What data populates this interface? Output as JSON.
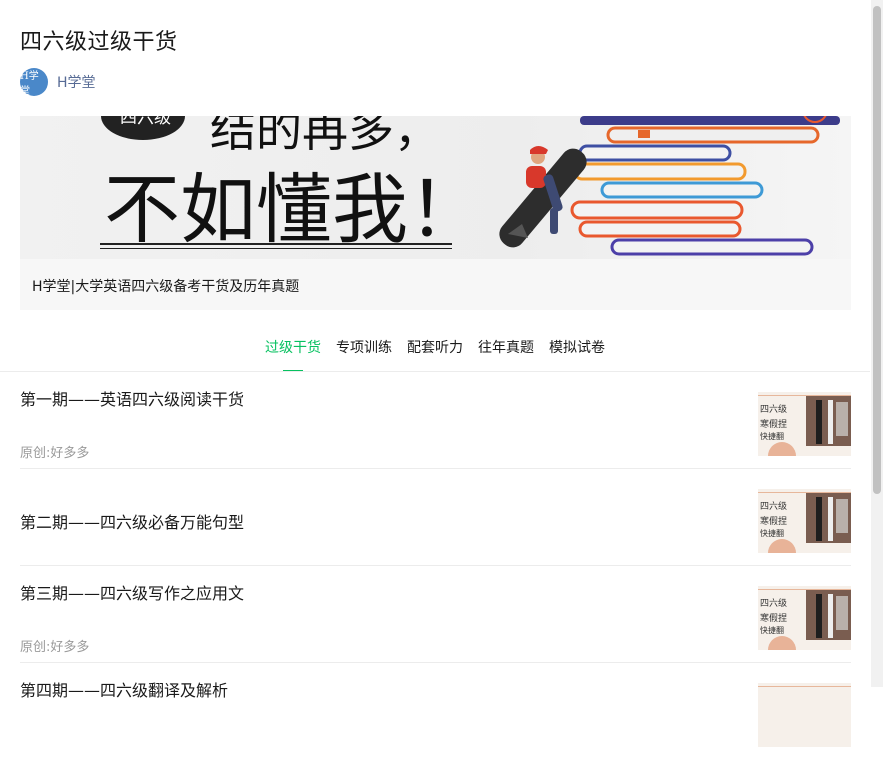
{
  "title": "四六级过级干货",
  "author": {
    "name": "H学堂",
    "avatar_text": "H学堂"
  },
  "banner": {
    "badge_text": "四六级",
    "line1": "结的再多，",
    "line1_highlight": "再多",
    "line2": "不如懂我！",
    "caption": "H学堂|大学英语四六级备考干货及历年真题"
  },
  "tabs": [
    {
      "label": "过级干货",
      "active": true
    },
    {
      "label": "专项训练"
    },
    {
      "label": "配套听力"
    },
    {
      "label": "往年真题"
    },
    {
      "label": "模拟试卷"
    }
  ],
  "articles": [
    {
      "title": "第一期——英语四六级阅读干货",
      "source": "原创:好多多"
    },
    {
      "title": "第二期——四六级必备万能句型",
      "source": ""
    },
    {
      "title": "第三期——四六级写作之应用文",
      "source": "原创:好多多"
    },
    {
      "title": "第四期——四六级翻译及解析",
      "source": ""
    }
  ],
  "thumb": {
    "line1": "四六级",
    "line2": "寒假捏",
    "line3": "快捷翻"
  },
  "colors": {
    "accent": "#07c160",
    "link": "#576b95",
    "avatar": "#4a88c9"
  },
  "icons": {
    "illustration": "pen-rider-illustration",
    "books": "book-stack-illustration"
  }
}
